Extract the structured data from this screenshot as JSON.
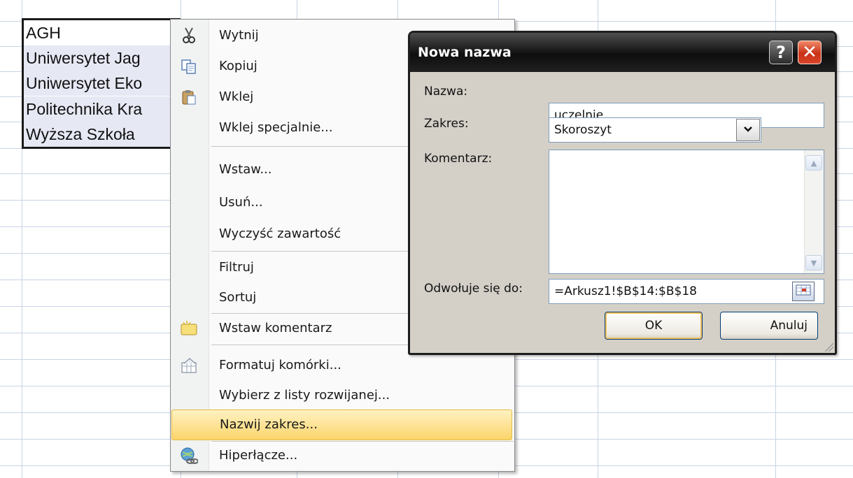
{
  "sheet": {
    "cells": [
      "AGH",
      "Uniwersytet Jag",
      "Uniwersytet Eko",
      "Politechnika Kra",
      "Wyższa Szkoła"
    ]
  },
  "context_menu": {
    "items": [
      {
        "label": "Wytnij",
        "icon": "scissors-icon"
      },
      {
        "label": "Kopiuj",
        "icon": "copy-icon"
      },
      {
        "label": "Wklej",
        "icon": "paste-icon"
      },
      {
        "label": "Wklej specjalnie...",
        "icon": ""
      },
      {
        "label": "Wstaw...",
        "icon": ""
      },
      {
        "label": "Usuń...",
        "icon": ""
      },
      {
        "label": "Wyczyść zawartość",
        "icon": ""
      },
      {
        "label": "Filtruj",
        "icon": ""
      },
      {
        "label": "Sortuj",
        "icon": ""
      },
      {
        "label": "Wstaw komentarz",
        "icon": "comment-icon"
      },
      {
        "label": "Formatuj komórki...",
        "icon": "format-cells-icon"
      },
      {
        "label": "Wybierz z listy rozwijanej...",
        "icon": ""
      },
      {
        "label": "Nazwij zakres...",
        "icon": ""
      },
      {
        "label": "Hiperłącze...",
        "icon": "hyperlink-icon"
      }
    ],
    "highlighted_item": "Nazwij zakres..."
  },
  "dialog": {
    "title": "Nowa nazwa",
    "help_label": "?",
    "close_label": "✕",
    "name_label": "Nazwa:",
    "name_value": "uczelnie",
    "scope_label": "Zakres:",
    "scope_value": "Skoroszyt",
    "comment_label": "Komentarz:",
    "comment_value": "",
    "refers_label": "Odwołuje się do:",
    "refers_value": "=Arkusz1!$B$14:$B$18",
    "ok_label": "OK",
    "cancel_label": "Anuluj"
  },
  "colors": {
    "highlight": "#fcd56b",
    "title_bar": "#0e0e0e",
    "close_button": "#c93216",
    "grid": "#c8d4e6"
  }
}
